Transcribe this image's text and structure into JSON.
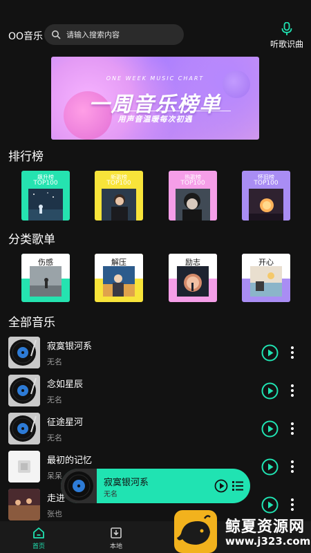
{
  "header": {
    "title": "OO音乐",
    "search_placeholder": "请输入搜索内容",
    "voice_label": "听歌识曲"
  },
  "banner": {
    "subtitle": "ONE WEEK MUSIC CHART",
    "title": "一周音乐榜单",
    "tagline": "用声音温暖每次初遇"
  },
  "sections": {
    "rank": "排行榜",
    "category": "分类歌单",
    "all": "全部音乐"
  },
  "rank_cards": [
    {
      "name": "飙升榜",
      "top": "TOP100",
      "color": "#25e3b0"
    },
    {
      "name": "新歌榜",
      "top": "TOP100",
      "color": "#f8e43a"
    },
    {
      "name": "热歌榜",
      "top": "TOP100",
      "color": "#f59ee8"
    },
    {
      "name": "怀旧榜",
      "top": "TOP100",
      "color": "#a98df4"
    }
  ],
  "category_cards": [
    {
      "name": "伤感",
      "color": "#25e3b0"
    },
    {
      "name": "解压",
      "color": "#f8e43a"
    },
    {
      "name": "励志",
      "color": "#f59ee8"
    },
    {
      "name": "开心",
      "color": "#a98df4"
    }
  ],
  "songs": [
    {
      "title": "寂寞银河系",
      "artist": "无名"
    },
    {
      "title": "念如星辰",
      "artist": "无名"
    },
    {
      "title": "征途星河",
      "artist": "无名"
    },
    {
      "title": "最初的记忆",
      "artist": "呆呆"
    },
    {
      "title": "走进",
      "artist": "张也"
    }
  ],
  "mini_player": {
    "title": "寂寞银河系",
    "artist": "无名"
  },
  "bottom_nav": [
    {
      "label": "首页",
      "active": true
    },
    {
      "label": "本地",
      "active": false
    }
  ],
  "watermark": {
    "name": "鲸夏资源网",
    "url": "www.j323.com"
  },
  "colors": {
    "accent": "#20e3b2",
    "background": "#121212"
  }
}
